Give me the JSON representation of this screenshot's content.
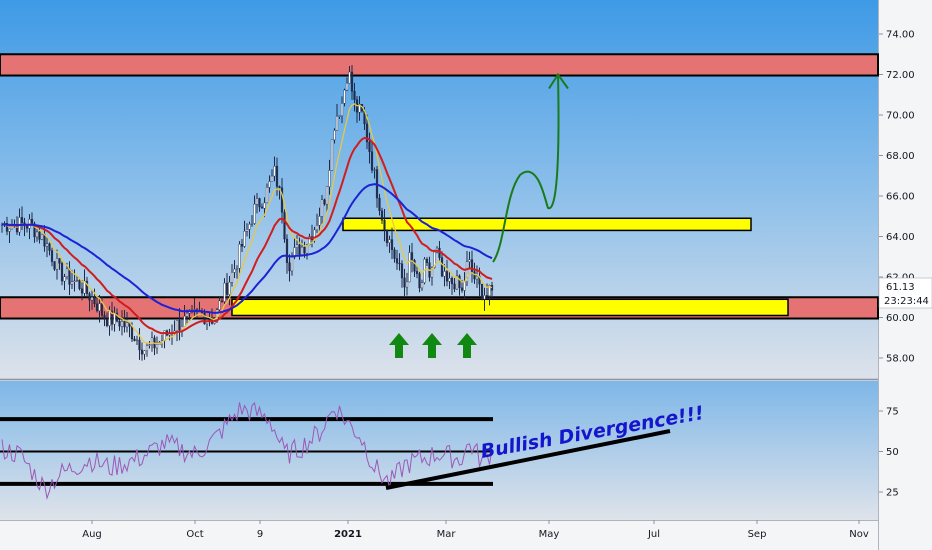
{
  "chart_data": [
    {
      "type": "candlestick",
      "panel": "price",
      "series": [
        {
          "name": "",
          "kind": "price"
        },
        {
          "name": "",
          "kind": "moving-average",
          "color": "#e5c84a"
        },
        {
          "name": "",
          "kind": "moving-average",
          "color": "#d11d1d"
        },
        {
          "name": "",
          "kind": "moving-average",
          "color": "#1c23d4"
        }
      ],
      "ylim": [
        56.9,
        75.2
      ],
      "y_ticks": [
        "74.00",
        "72.00",
        "70.00",
        "68.00",
        "66.00",
        "64.00",
        "62.00",
        "60.00",
        "58.00"
      ],
      "x_ticks": [
        "Aug",
        "Oct",
        "9",
        "2021",
        "Mar",
        "May",
        "Jul",
        "Sep",
        "Nov"
      ],
      "last_price": "61.13",
      "countdown": "23:23:44",
      "zones": [
        {
          "y_from": 71.95,
          "y_to": 73.0,
          "color": "#e57373"
        },
        {
          "y_from": 59.95,
          "y_to": 61.0,
          "color": "#e57373"
        },
        {
          "y_from": 60.1,
          "y_to": 60.9,
          "color": "#ffff00"
        },
        {
          "y_from": 64.3,
          "y_to": 64.9,
          "color": "#ffff00"
        }
      ],
      "annotations": [
        {
          "type": "arrow-up",
          "count": 3,
          "color": "#118811"
        },
        {
          "type": "projected-path",
          "color": "#1b7a1b",
          "target": 72.0
        }
      ]
    },
    {
      "type": "line",
      "panel": "oscillator",
      "series": [
        {
          "name": "",
          "color": "#9b59b6"
        }
      ],
      "ylim": [
        10,
        90
      ],
      "y_ticks": [
        "75",
        "50",
        "25"
      ],
      "horizontal_levels": [
        70,
        50,
        30
      ],
      "annotation_text": "Bullish Divergence!!!"
    }
  ],
  "colors": {
    "bg_top": "#3f9be6",
    "bg_bottom": "#dfe3ea",
    "candle": "#1e2a4a",
    "axis_bg": "#f5f6f8"
  }
}
